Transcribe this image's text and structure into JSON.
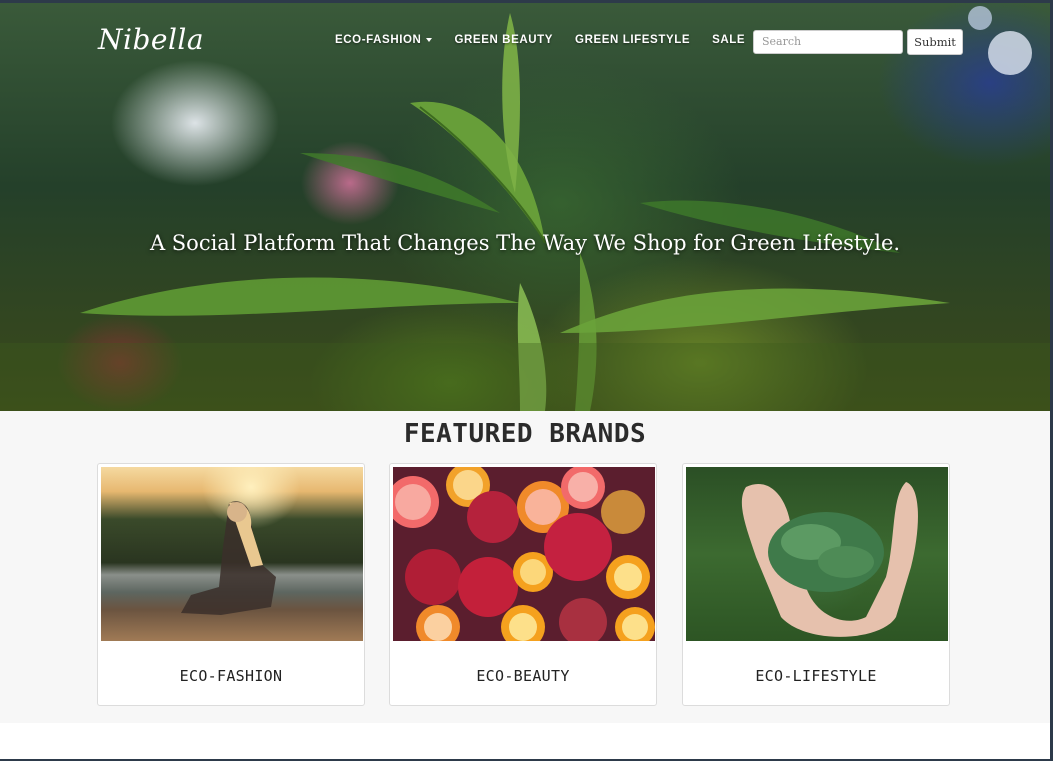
{
  "brand": {
    "logo": "Nibella"
  },
  "nav": {
    "items": [
      {
        "label": "ECO-FASHION",
        "has_dropdown": true
      },
      {
        "label": "GREEN BEAUTY",
        "has_dropdown": false
      },
      {
        "label": "GREEN LIFESTYLE",
        "has_dropdown": false
      },
      {
        "label": "SALE",
        "has_dropdown": false
      }
    ]
  },
  "search": {
    "placeholder": "Search",
    "value": "",
    "submit_label": "Submit"
  },
  "hero": {
    "tagline": "A Social Platform That Changes The Way We Shop for Green Lifestyle.",
    "image": "forest-plant-moss-photo"
  },
  "featured": {
    "title": "FEATURED BRANDS",
    "cards": [
      {
        "label": "ECO-FASHION",
        "image": "woman-sunset-lake-photo"
      },
      {
        "label": "ECO-BEAUTY",
        "image": "citrus-pomegranate-fruits-photo"
      },
      {
        "label": "ECO-LIFESTYLE",
        "image": "hands-holding-pine-sprigs-photo"
      }
    ]
  },
  "colors": {
    "hero_text": "#ffffff",
    "section_bg": "#f7f7f7",
    "card_border": "#dcdcdc",
    "frame": "#2d3a4a"
  }
}
